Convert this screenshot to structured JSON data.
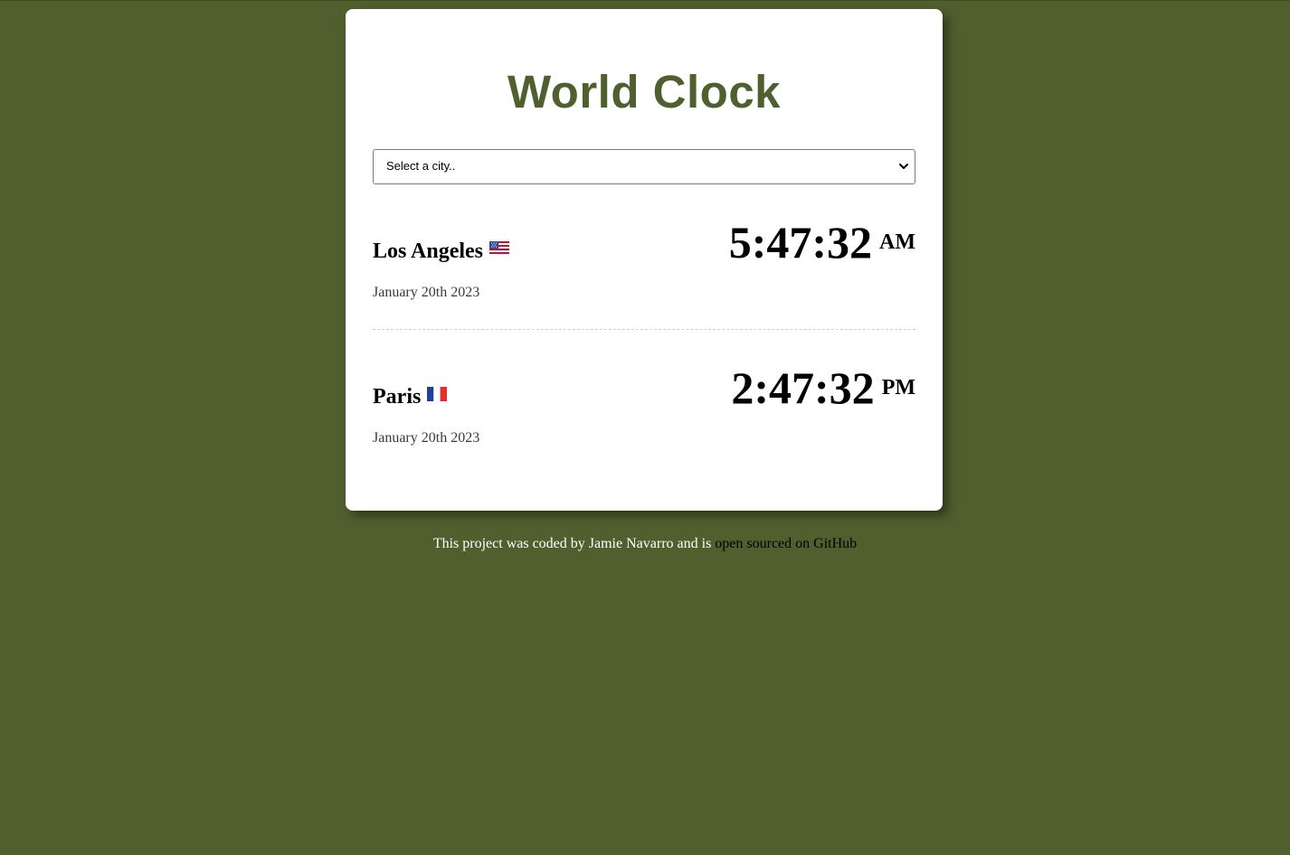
{
  "app": {
    "title": "World Clock"
  },
  "city_select": {
    "selected": "Select a city.."
  },
  "cities": [
    {
      "name": "Los Angeles",
      "flag": "us-flag",
      "date": "January 20th 2023",
      "time": "5:47:32",
      "ampm": "AM"
    },
    {
      "name": "Paris",
      "flag": "fr-flag",
      "date": "January 20th 2023",
      "time": "2:47:32",
      "ampm": "PM"
    }
  ],
  "footer": {
    "text": "This project was coded by Jamie Navarro and is ",
    "link_text": "open sourced on GitHub"
  },
  "colors": {
    "background": "#4f5f2e",
    "title": "#4f5f2e",
    "card": "#ffffff",
    "link": "#000000"
  }
}
